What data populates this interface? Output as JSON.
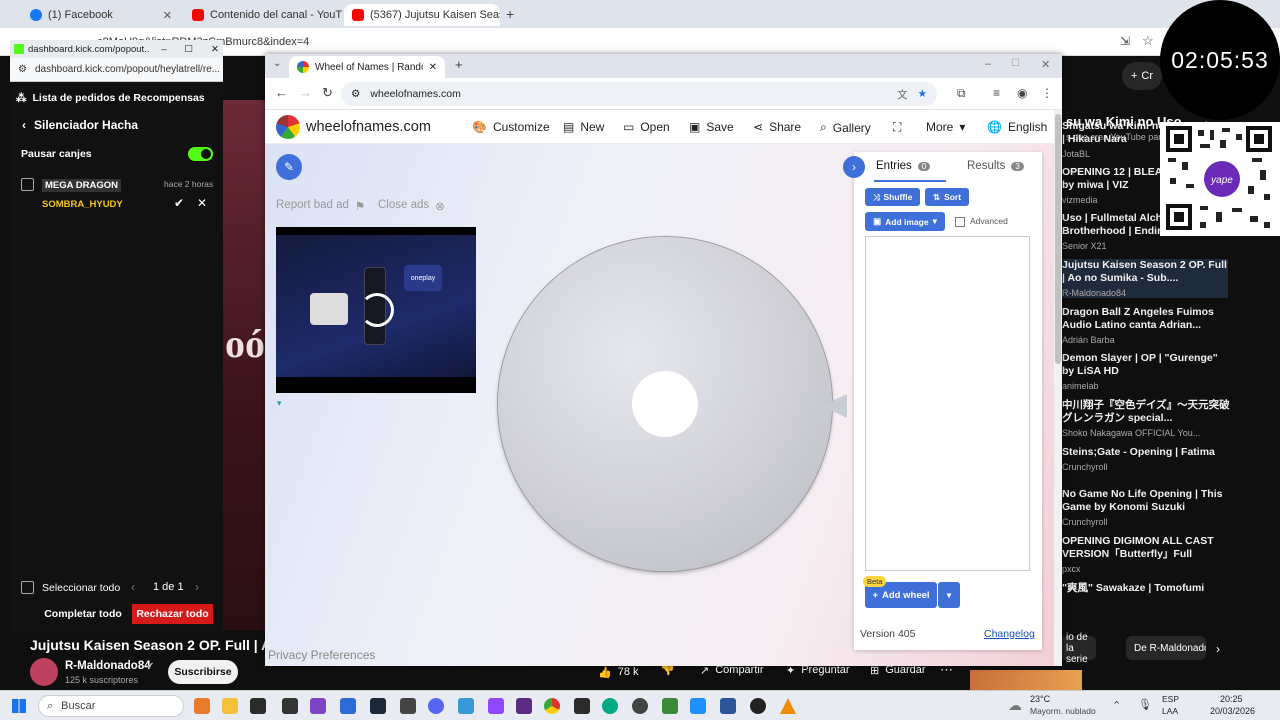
{
  "bg_browser": {
    "tabs": [
      {
        "label": "(1) Facebook",
        "color": "#1877f2"
      },
      {
        "label": "Contenido del canal - YouTube",
        "color": "#ff0000"
      },
      {
        "label": "(5367) Jujutsu Kaisen Season",
        "color": "#ff0000"
      }
    ],
    "url": "...c8MoU9g&list=RDM3zCmBmurc8&index=4",
    "crear_label": "Cr"
  },
  "clock": "02:05:53",
  "kick": {
    "window_title": "dashboard.kick.com/popout...",
    "url": "dashboard.kick.com/popout/heylatrell/re...",
    "header": "Lista de pedidos de Recompensas",
    "back_title": "Silenciador Hacha",
    "pause_label": "Pausar canjes",
    "redemption": {
      "title": "MEGA DRAGON",
      "time": "hace 2 horas",
      "user": "SOMBRA_HYUDY"
    },
    "select_all": "Seleccionar todo",
    "pager": "1 de 1",
    "complete_all": "Completar todo",
    "reject_all": "Rechazar todo"
  },
  "video": {
    "overlay_text": "oó/"
  },
  "yt": {
    "video_title": "Jujutsu Kaisen Season 2 OP. Full | Ao no",
    "channel": "R-Maldonado84",
    "subscribers": "125 k suscriptores",
    "subscribe": "Suscribirse",
    "likes": "78 k",
    "share": "Compartir",
    "ask": "Preguntar",
    "save": "Guardar",
    "chip1": "io de la serie",
    "chip2": "De R-Maldonado",
    "top_title": "su wa Kimi no Uso",
    "top_sub": "s que crea YouTube para ti",
    "playlist": [
      {
        "title": "Shigatsu wa Kimi no U Opening 1 | Hikaru Nara",
        "channel": "JotaBL"
      },
      {
        "title": "OPENING 12 | BLEACH | chAngE by miwa | VIZ",
        "channel": "vizmedia"
      },
      {
        "title": "Uso | Fullmetal Alchemist Brotherhood | Ending 1...",
        "channel": "Senior X21"
      },
      {
        "title": "Jujutsu Kaisen Season 2 OP. Full | Ao no Sumika - Sub....",
        "channel": "R-Maldonado84"
      },
      {
        "title": "Dragon Ball Z Angeles Fuimos Audio Latino canta Adrian...",
        "channel": "Adrián Barba"
      },
      {
        "title": "Demon Slayer | OP | \"Gurenge\" by LiSA HD",
        "channel": "animelab"
      },
      {
        "title": "中川翔子『空色デイズ』～天元突破グレンラガン special...",
        "channel": "Shoko Nakagawa OFFICIAL You..."
      },
      {
        "title": "Steins;Gate - Opening | Fatima",
        "channel": "Crunchyroll"
      },
      {
        "title": "No Game No Life Opening | This Game by Konomi Suzuki",
        "channel": "Crunchyroll"
      },
      {
        "title": "OPENING DIGIMON ALL CAST VERSION「Butterfly」Full",
        "channel": "pxcx"
      },
      {
        "title": "\"爽風\" Sawakaze | Tomofumi",
        "channel": ""
      }
    ]
  },
  "wheel_browser": {
    "tab_title": "Wheel of Names | Random nam",
    "url": "wheelofnames.com"
  },
  "wheel_site": {
    "logo": "wheelofnames.com",
    "menu": [
      "Customize",
      "New",
      "Open",
      "Save",
      "Share",
      "Gallery",
      "More",
      "English"
    ],
    "report_ad": "Report bad ad",
    "close_ads": "Close ads",
    "ad_brand": "oneplay",
    "privacy": "Privacy Preferences",
    "entries_tab": "Entries",
    "entries_count": "0",
    "results_tab": "Results",
    "results_count": "3",
    "shuffle": "Shuffle",
    "sort": "Sort",
    "add_image": "Add image",
    "advanced": "Advanced",
    "beta": "Beta",
    "add_wheel": "Add wheel",
    "version": "Version 405",
    "changelog": "Changelog"
  },
  "taskbar": {
    "search": "Buscar",
    "weather_temp": "23°C",
    "weather_desc": "Mayorm. nublado",
    "lang": "ESP",
    "lang2": "LAA",
    "time": "20:25",
    "date": "20/03/2026"
  }
}
